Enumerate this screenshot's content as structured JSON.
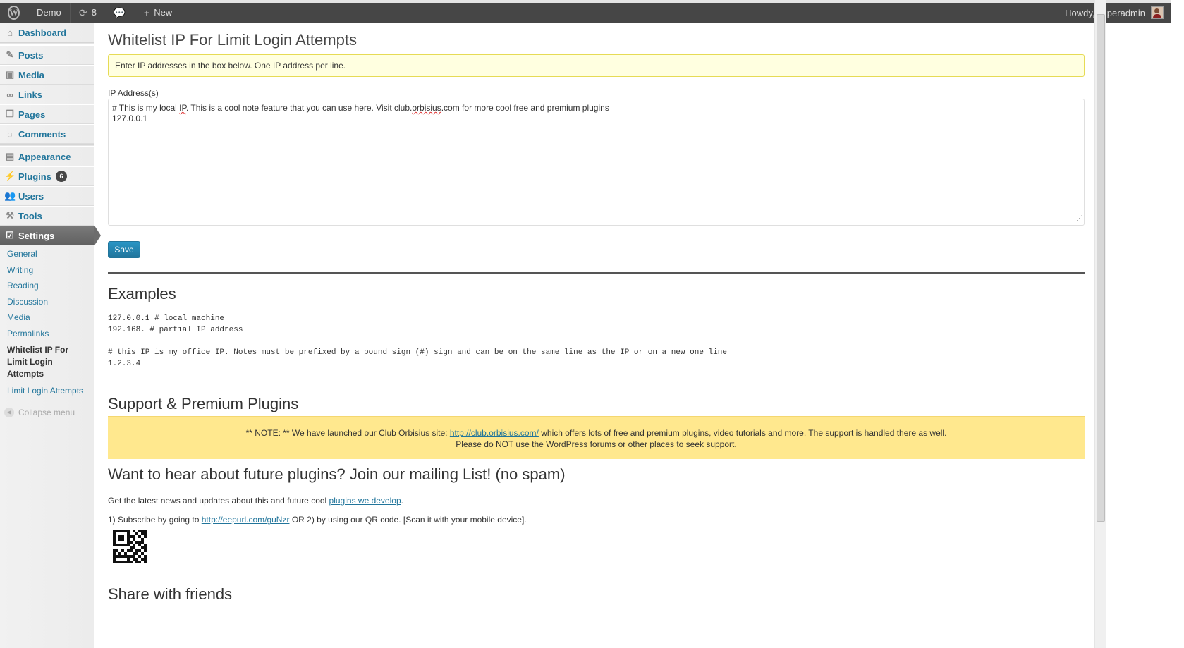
{
  "adminbar": {
    "site_name": "Demo",
    "updates_count": "8",
    "new_label": "New",
    "greeting": "Howdy, superadmin"
  },
  "sidebar": {
    "items": [
      {
        "label": "Dashboard",
        "icon": "dashboard-icon"
      },
      {
        "label": "Posts",
        "icon": "pin-icon"
      },
      {
        "label": "Media",
        "icon": "media-icon"
      },
      {
        "label": "Links",
        "icon": "link-icon"
      },
      {
        "label": "Pages",
        "icon": "pages-icon"
      },
      {
        "label": "Comments",
        "icon": "comment-icon"
      },
      {
        "label": "Appearance",
        "icon": "appearance-icon"
      },
      {
        "label": "Plugins",
        "icon": "plugin-icon",
        "badge": "6"
      },
      {
        "label": "Users",
        "icon": "users-icon"
      },
      {
        "label": "Tools",
        "icon": "tools-icon"
      },
      {
        "label": "Settings",
        "icon": "settings-icon",
        "current": true
      }
    ],
    "submenu": [
      {
        "label": "General"
      },
      {
        "label": "Writing"
      },
      {
        "label": "Reading"
      },
      {
        "label": "Discussion"
      },
      {
        "label": "Media"
      },
      {
        "label": "Permalinks"
      },
      {
        "label": "Whitelist IP For Limit Login Attempts",
        "current": true
      },
      {
        "label": "Limit Login Attempts"
      }
    ],
    "collapse_label": "Collapse menu"
  },
  "main": {
    "title": "Whitelist IP For Limit Login Attempts",
    "notice": "Enter IP addresses in the box below. One IP address per line.",
    "field_label": "IP Address(s)",
    "textarea": {
      "line1_before": "# This is my local ",
      "line1_ip": "IP",
      "line1_mid": ". This is a cool note feature that you can use here. Visit club.",
      "line1_orbisius": "orbisius",
      "line1_after": ".com for more cool free and premium plugins",
      "line2": "127.0.0.1"
    },
    "save_label": "Save",
    "examples": {
      "heading": "Examples",
      "lines": [
        "127.0.0.1 # local machine",
        "192.168. # partial IP address",
        "# this IP is my office IP. Notes must be prefixed by a pound sign (#) sign and can be on the same line as the IP or on a new one line",
        "1.2.3.4"
      ]
    },
    "support": {
      "heading": "Support & Premium Plugins",
      "line1_before": "** NOTE: ** We have launched our Club Orbisius site: ",
      "line1_link": "http://club.orbisius.com/",
      "line1_after": " which offers lots of free and premium plugins, video tutorials and more. The support is handled there as well.",
      "line2": "Please do NOT use the WordPress forums or other places to seek support."
    },
    "mailing": {
      "heading": "Want to hear about future plugins? Join our mailing List! (no spam)",
      "p1_before": "Get the latest news and updates about this and future cool ",
      "p1_link": "plugins we develop",
      "p1_after": ".",
      "p2_before": "1) Subscribe by going to ",
      "p2_link": "http://eepurl.com/guNzr",
      "p2_after": " OR 2) by using our QR code. [Scan it with your mobile device]."
    },
    "share": {
      "heading": "Share with friends"
    }
  },
  "colors": {
    "link": "#21759b",
    "adminbar_bg": "#464646",
    "notice_bg": "#ffffe0",
    "support_bg": "#ffe88e",
    "button_bg": "#21759b"
  }
}
